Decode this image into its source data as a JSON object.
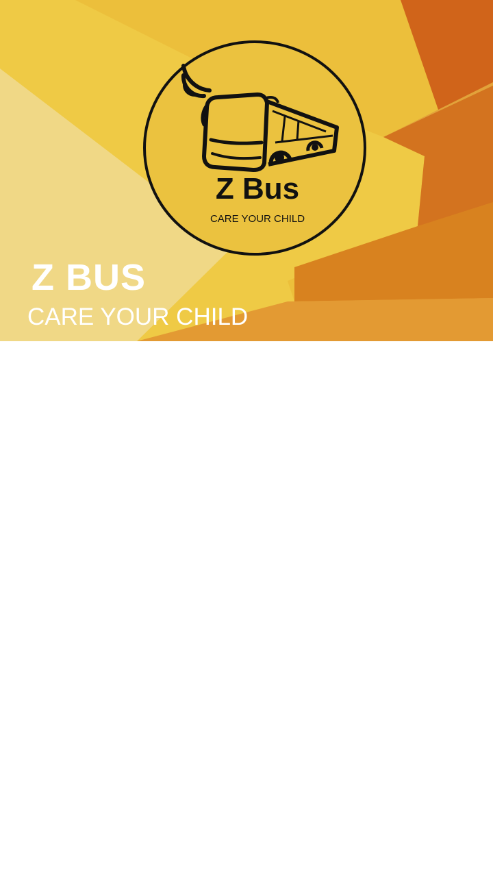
{
  "colors": {
    "header_orange_dark": "#d0641a",
    "header_orange": "#e39a33",
    "header_yellow": "#ecc43e",
    "header_pale_yellow": "#f0d886",
    "logo_circle_fill": "#ebc23f",
    "logo_ink": "#111111",
    "brand_text": "#ffffff",
    "content_background": "#ffffff"
  },
  "logo": {
    "icon": "bus-wifi-icon",
    "title": "Z Bus",
    "tagline": "CARE YOUR CHILD"
  },
  "brand": {
    "title": "Z BUS",
    "tagline": "CARE YOUR CHILD"
  }
}
